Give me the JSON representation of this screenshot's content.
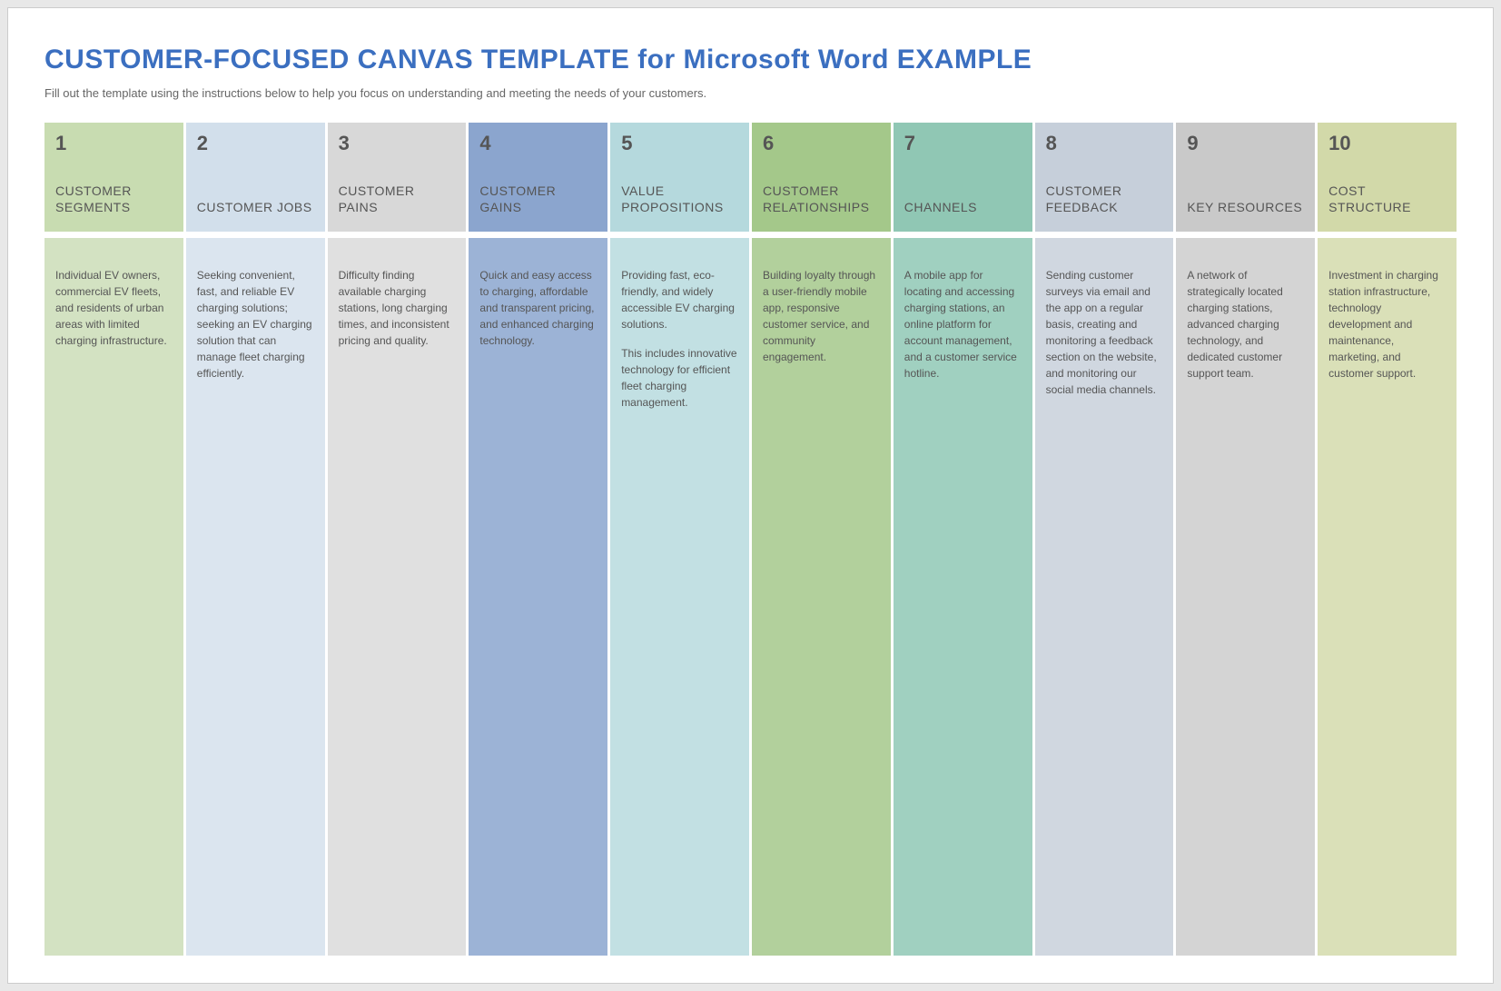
{
  "title": "CUSTOMER-FOCUSED CANVAS TEMPLATE for Microsoft Word EXAMPLE",
  "subtitle": "Fill out the template using the instructions below to help you focus on understanding and meeting the needs of your customers.",
  "columns": [
    {
      "num": "1",
      "title": "CUSTOMER SEGMENTS",
      "body": "Individual EV owners, commercial EV fleets, and residents of urban areas with limited charging infrastructure.",
      "extra": ""
    },
    {
      "num": "2",
      "title": "CUSTOMER JOBS",
      "body": "Seeking convenient, fast, and reliable EV charging solutions; seeking an EV charging solution that can manage fleet charging efficiently.",
      "extra": ""
    },
    {
      "num": "3",
      "title": "CUSTOMER PAINS",
      "body": "Difficulty finding available charging stations, long charging times, and inconsistent pricing and quality.",
      "extra": ""
    },
    {
      "num": "4",
      "title": "CUSTOMER GAINS",
      "body": "Quick and easy access to charging, affordable and transparent pricing, and enhanced charging technology.",
      "extra": ""
    },
    {
      "num": "5",
      "title": "VALUE PROPOSITIONS",
      "body": "Providing fast, eco-friendly, and widely accessible EV charging solutions.",
      "extra": "This includes innovative technology for efficient fleet charging management."
    },
    {
      "num": "6",
      "title": "CUSTOMER RELATIONSHIPS",
      "body": "Building loyalty through a user-friendly mobile app, responsive customer service, and community engagement.",
      "extra": ""
    },
    {
      "num": "7",
      "title": "CHANNELS",
      "body": "A mobile app for locating and accessing charging stations, an online platform for account management, and a customer service hotline.",
      "extra": ""
    },
    {
      "num": "8",
      "title": "CUSTOMER FEEDBACK",
      "body": "Sending customer surveys via email and the app on a regular basis, creating and monitoring a feedback section on the website, and monitoring our social media channels.",
      "extra": ""
    },
    {
      "num": "9",
      "title": "KEY RESOURCES",
      "body": "A network of strategically located charging stations, advanced charging technology, and dedicated customer support team.",
      "extra": ""
    },
    {
      "num": "10",
      "title": "COST STRUCTURE",
      "body": "Investment in charging station infrastructure, technology development and maintenance, marketing, and customer support.",
      "extra": ""
    }
  ]
}
